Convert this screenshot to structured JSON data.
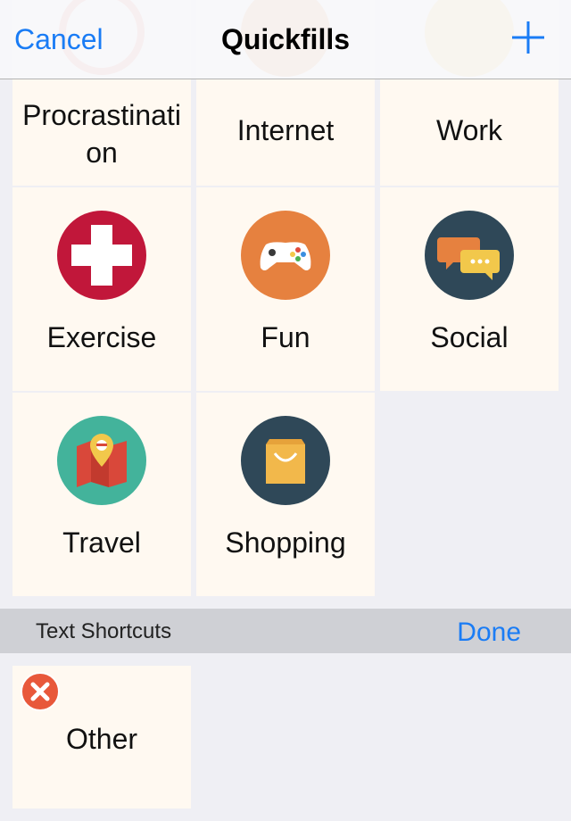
{
  "navbar": {
    "cancel_label": "Cancel",
    "title": "Quickfills",
    "add_icon": "plus-icon"
  },
  "grid": {
    "tiles": [
      {
        "label": "Procrastination",
        "icon": "procrastination-icon",
        "color": "#e06050"
      },
      {
        "label": "Internet",
        "icon": "internet-icon",
        "color": "#e6813f"
      },
      {
        "label": "Work",
        "icon": "work-icon",
        "color": "#f2c84b"
      },
      {
        "label": "Exercise",
        "icon": "medical-cross-icon",
        "color": "#c1173a"
      },
      {
        "label": "Fun",
        "icon": "game-controller-icon",
        "color": "#e6813f"
      },
      {
        "label": "Social",
        "icon": "chat-bubbles-icon",
        "color": "#2f4858"
      },
      {
        "label": "Travel",
        "icon": "map-pin-icon",
        "color": "#43b39b"
      },
      {
        "label": "Shopping",
        "icon": "shopping-bag-icon",
        "color": "#2f4858"
      }
    ]
  },
  "section": {
    "title": "Text Shortcuts",
    "done_label": "Done"
  },
  "shortcuts": {
    "tiles": [
      {
        "label": "Other",
        "badge_icon": "delete-icon"
      }
    ]
  },
  "colors": {
    "accent": "#1a7cf5",
    "tile_bg": "#fff9f1",
    "page_bg": "#efeff4",
    "section_bg": "#cfd0d5"
  }
}
